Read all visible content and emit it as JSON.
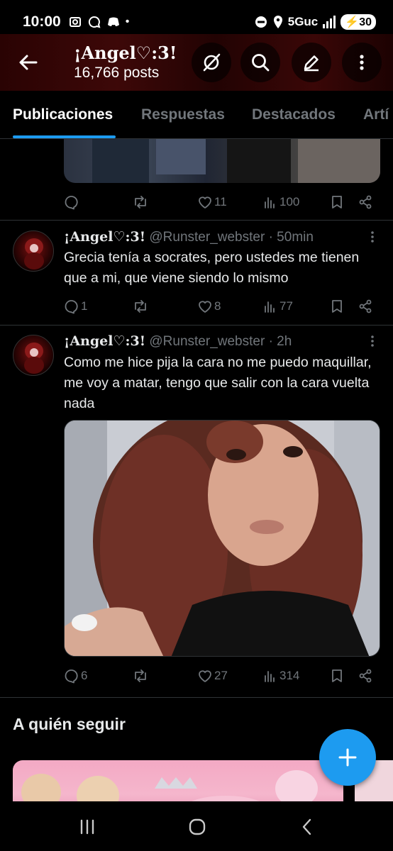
{
  "status_bar": {
    "time": "10:00",
    "network": "5Guc",
    "battery": "30"
  },
  "header": {
    "name": "¡Angel♡:3!",
    "post_count": "16,766 posts"
  },
  "tabs": [
    {
      "label": "Publicaciones",
      "active": true
    },
    {
      "label": "Respuestas",
      "active": false
    },
    {
      "label": "Destacados",
      "active": false
    },
    {
      "label": "Artí",
      "active": false
    }
  ],
  "tweets": [
    {
      "replies": "",
      "retweets": "",
      "likes": "11",
      "views": "100"
    },
    {
      "name": "¡Angel♡:3!",
      "meta": "@Runster_webster · 50min",
      "text": "Grecia tenía a socrates, pero ustedes me tienen que a mi, que viene siendo lo mismo",
      "replies": "1",
      "retweets": "",
      "likes": "8",
      "views": "77"
    },
    {
      "name": "¡Angel♡:3!",
      "meta": "@Runster_webster · 2h",
      "text": "Como me hice pija la cara no me puedo maquillar, me voy a matar, tengo que salir con la cara vuelta nada",
      "replies": "6",
      "retweets": "",
      "likes": "27",
      "views": "314"
    }
  ],
  "who_to_follow": {
    "title": "A quién seguir"
  },
  "colors": {
    "accent": "#1d9bf0",
    "muted": "#71767b",
    "header_bg": "#3d0808"
  }
}
